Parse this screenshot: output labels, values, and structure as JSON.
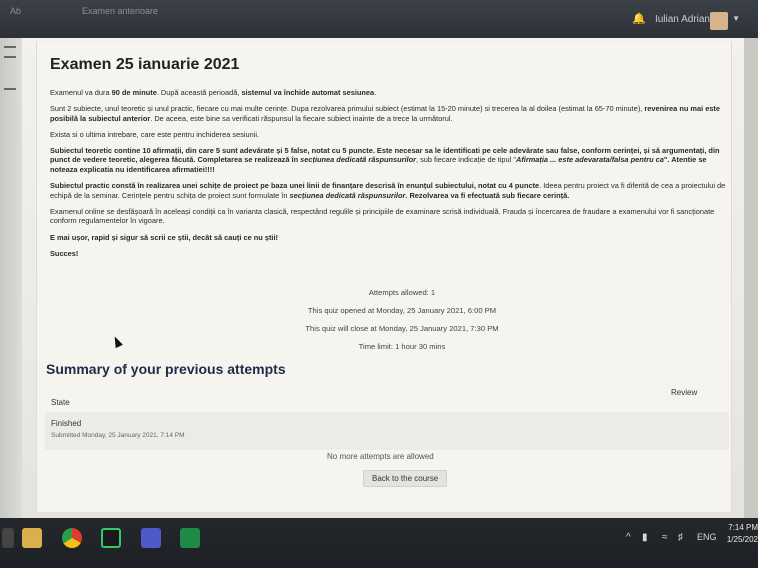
{
  "topbar": {
    "tab1": "Ab",
    "tab2": "Examen anterioare",
    "user_name": "Iulian Adrian"
  },
  "exam": {
    "title": "Examen 25 ianuarie 2021",
    "p1_a": "Examenul va dura ",
    "p1_b": "90 de minute",
    "p1_c": ". După această perioadă, ",
    "p1_d": "sistemul va închide automat sesiunea",
    "p1_e": ".",
    "p2_a": "Sunt 2 subiecte, unul teoretic și unul practic, fiecare cu mai multe cerințe. Dupa rezolvarea primului subiect (estimat la 15-20 minute) si trecerea la al doilea (estimat la 65-70 minute), ",
    "p2_b": "revenirea nu mai este posibilă la subiectul anterior",
    "p2_c": ". De aceea, este bine sa verificati răspunsul la fiecare subiect inainte de a trece la următorul.",
    "p3": "Exista si o ultima intrebare, care este pentru inchiderea sesiunii.",
    "p4_a": "Subiectul teoretic contine 10 afirmații, din care 5 sunt adevărate și 5 false, notat cu 5 puncte. Este necesar sa le identificati pe cele adevărate sau false, conform cerinței, și să argumentați, din punct de vedere teoretic, alegerea făcută. Completarea se realizează în ",
    "p4_b": "secțiunea dedicată răspunsurilor",
    "p4_c": ", sub fiecare indicație de tipul \"",
    "p4_d": "Afirmația ... este adevarata/falsa pentru ca",
    "p4_e": "\". Atentie se noteaza explicatia nu identificarea afirmatiei!!!!",
    "p5_a": "Subiectul practic constă în realizarea unei schițe de proiect pe baza unei linii de finanțare descrisă în enunțul subiectului, ",
    "p5_b": "notat cu 4 puncte",
    "p5_c": ". Ideea pentru proiect va fi diferită de cea a proiectului de echipă de la seminar. Cerințele pentru schița de proiect sunt formulate în ",
    "p5_d": "secțiunea dedicată răspunsurilor",
    "p5_e": ". Rezolvarea va fi efectuată sub fiecare cerință.",
    "p6": "Examenul online se desfășoară în aceleași condiții ca în varianta clasică, respectând regulile și principiile de examinare scrisă individuală. Frauda și încercarea de fraudare a examenului vor fi sancționate conform regulamentelor în vigoare.",
    "p7": "E mai ușor, rapid și sigur să scrii ce știi, decât să cauți ce nu știi!",
    "p8": "Succes!"
  },
  "quiz_info": {
    "attempts": "Attempts allowed: 1",
    "opened": "This quiz opened at Monday, 25 January 2021, 6:00 PM",
    "close": "This quiz will close at Monday, 25 January 2021, 7:30 PM",
    "limit": "Time limit: 1 hour 30 mins"
  },
  "summary": {
    "title": "Summary of your previous attempts",
    "col_state": "State",
    "col_review": "Review",
    "row_state": "Finished",
    "row_submitted": "Submitted Monday, 25 January 2021, 7:14 PM",
    "no_more": "No more attempts are allowed",
    "back_button": "Back to the course"
  },
  "taskbar": {
    "lang": "ENG",
    "time": "7:14 PM",
    "date": "1/25/202"
  },
  "icons": [
    "windows-icon",
    "folder-icon",
    "chrome-icon",
    "pycharm-icon",
    "teams-icon",
    "excel-icon",
    "chevron-up-icon",
    "battery-icon",
    "wifi-icon",
    "volume-icon"
  ]
}
